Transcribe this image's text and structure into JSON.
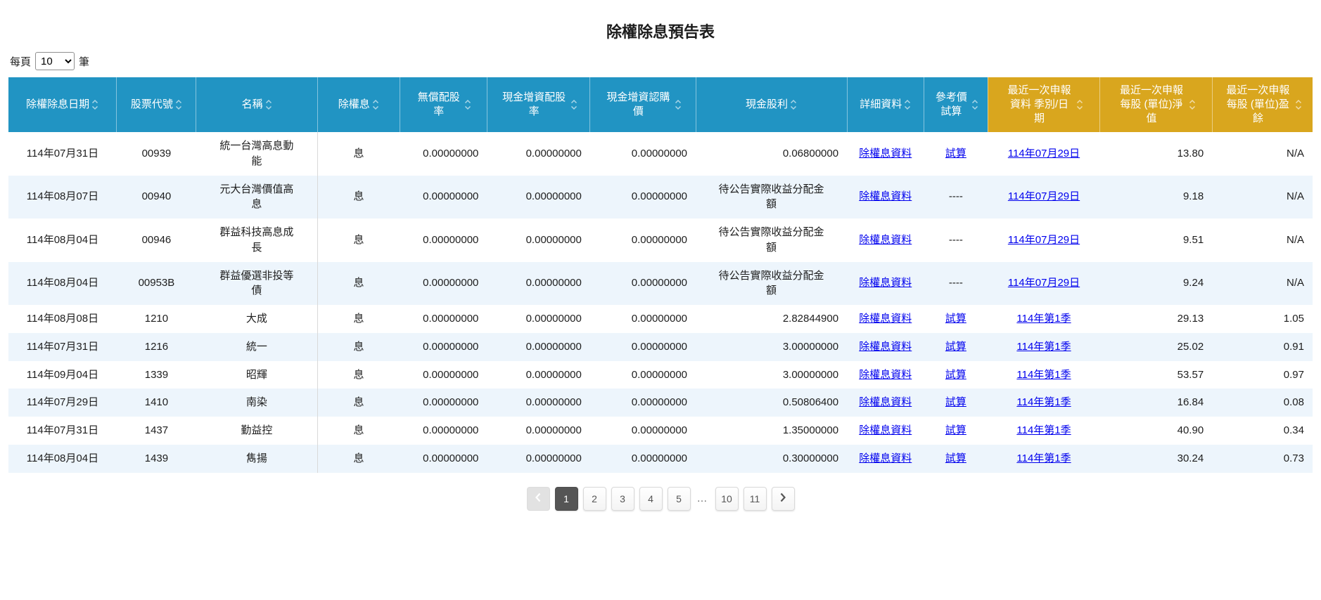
{
  "page": {
    "title": "除權除息預告表"
  },
  "per_page": {
    "label_prefix": "每頁",
    "selected": "10",
    "options": [
      "10"
    ],
    "label_suffix": "筆"
  },
  "table": {
    "columns": [
      {
        "label": "除權除息日期",
        "group": "blue"
      },
      {
        "label": "股票代號",
        "group": "blue"
      },
      {
        "label": "名稱",
        "group": "blue"
      },
      {
        "label": "除權息",
        "group": "blue"
      },
      {
        "label": "無償配股率",
        "group": "blue"
      },
      {
        "label": "現金增資配股率",
        "group": "blue"
      },
      {
        "label": "現金增資認購價",
        "group": "blue"
      },
      {
        "label": "現金股利",
        "group": "blue"
      },
      {
        "label": "詳細資料",
        "group": "blue"
      },
      {
        "label": "參考價試算",
        "group": "blue"
      },
      {
        "label": "最近一次申報資料 季別/日期",
        "group": "gold"
      },
      {
        "label": "最近一次申報每股 (單位)淨值",
        "group": "gold"
      },
      {
        "label": "最近一次申報每股 (單位)盈餘",
        "group": "gold"
      }
    ],
    "rows": [
      {
        "date": "114年07月31日",
        "code": "00939",
        "name": "統一台灣高息動能",
        "type": "息",
        "stock_dividend_rate": "0.00000000",
        "capital_increase_rate": "0.00000000",
        "subscription_price": "0.00000000",
        "cash_dividend": "0.06800000",
        "detail": "除權息資料",
        "calc": "試算",
        "report_period": "114年07月29日",
        "net_value": "13.80",
        "eps": "N/A"
      },
      {
        "date": "114年08月07日",
        "code": "00940",
        "name": "元大台灣價值高息",
        "type": "息",
        "stock_dividend_rate": "0.00000000",
        "capital_increase_rate": "0.00000000",
        "subscription_price": "0.00000000",
        "cash_dividend": "待公告實際收益分配金額",
        "detail": "除權息資料",
        "calc": "----",
        "report_period": "114年07月29日",
        "net_value": "9.18",
        "eps": "N/A"
      },
      {
        "date": "114年08月04日",
        "code": "00946",
        "name": "群益科技高息成長",
        "type": "息",
        "stock_dividend_rate": "0.00000000",
        "capital_increase_rate": "0.00000000",
        "subscription_price": "0.00000000",
        "cash_dividend": "待公告實際收益分配金額",
        "detail": "除權息資料",
        "calc": "----",
        "report_period": "114年07月29日",
        "net_value": "9.51",
        "eps": "N/A"
      },
      {
        "date": "114年08月04日",
        "code": "00953B",
        "name": "群益優選非投等債",
        "type": "息",
        "stock_dividend_rate": "0.00000000",
        "capital_increase_rate": "0.00000000",
        "subscription_price": "0.00000000",
        "cash_dividend": "待公告實際收益分配金額",
        "detail": "除權息資料",
        "calc": "----",
        "report_period": "114年07月29日",
        "net_value": "9.24",
        "eps": "N/A"
      },
      {
        "date": "114年08月08日",
        "code": "1210",
        "name": "大成",
        "type": "息",
        "stock_dividend_rate": "0.00000000",
        "capital_increase_rate": "0.00000000",
        "subscription_price": "0.00000000",
        "cash_dividend": "2.82844900",
        "detail": "除權息資料",
        "calc": "試算",
        "report_period": "114年第1季",
        "net_value": "29.13",
        "eps": "1.05"
      },
      {
        "date": "114年07月31日",
        "code": "1216",
        "name": "統一",
        "type": "息",
        "stock_dividend_rate": "0.00000000",
        "capital_increase_rate": "0.00000000",
        "subscription_price": "0.00000000",
        "cash_dividend": "3.00000000",
        "detail": "除權息資料",
        "calc": "試算",
        "report_period": "114年第1季",
        "net_value": "25.02",
        "eps": "0.91"
      },
      {
        "date": "114年09月04日",
        "code": "1339",
        "name": "昭輝",
        "type": "息",
        "stock_dividend_rate": "0.00000000",
        "capital_increase_rate": "0.00000000",
        "subscription_price": "0.00000000",
        "cash_dividend": "3.00000000",
        "detail": "除權息資料",
        "calc": "試算",
        "report_period": "114年第1季",
        "net_value": "53.57",
        "eps": "0.97"
      },
      {
        "date": "114年07月29日",
        "code": "1410",
        "name": "南染",
        "type": "息",
        "stock_dividend_rate": "0.00000000",
        "capital_increase_rate": "0.00000000",
        "subscription_price": "0.00000000",
        "cash_dividend": "0.50806400",
        "detail": "除權息資料",
        "calc": "試算",
        "report_period": "114年第1季",
        "net_value": "16.84",
        "eps": "0.08"
      },
      {
        "date": "114年07月31日",
        "code": "1437",
        "name": "勤益控",
        "type": "息",
        "stock_dividend_rate": "0.00000000",
        "capital_increase_rate": "0.00000000",
        "subscription_price": "0.00000000",
        "cash_dividend": "1.35000000",
        "detail": "除權息資料",
        "calc": "試算",
        "report_period": "114年第1季",
        "net_value": "40.90",
        "eps": "0.34"
      },
      {
        "date": "114年08月04日",
        "code": "1439",
        "name": "雋揚",
        "type": "息",
        "stock_dividend_rate": "0.00000000",
        "capital_increase_rate": "0.00000000",
        "subscription_price": "0.00000000",
        "cash_dividend": "0.30000000",
        "detail": "除權息資料",
        "calc": "試算",
        "report_period": "114年第1季",
        "net_value": "30.24",
        "eps": "0.73"
      }
    ]
  },
  "pagination": {
    "pages": [
      "1",
      "2",
      "3",
      "4",
      "5",
      "…",
      "10",
      "11"
    ],
    "active": "1"
  },
  "colors": {
    "header_blue": "#2194C3",
    "header_gold": "#D9A61E",
    "row_alt": "#EDF5FC",
    "link": "#0000EE",
    "active_page_bg": "#555555"
  }
}
